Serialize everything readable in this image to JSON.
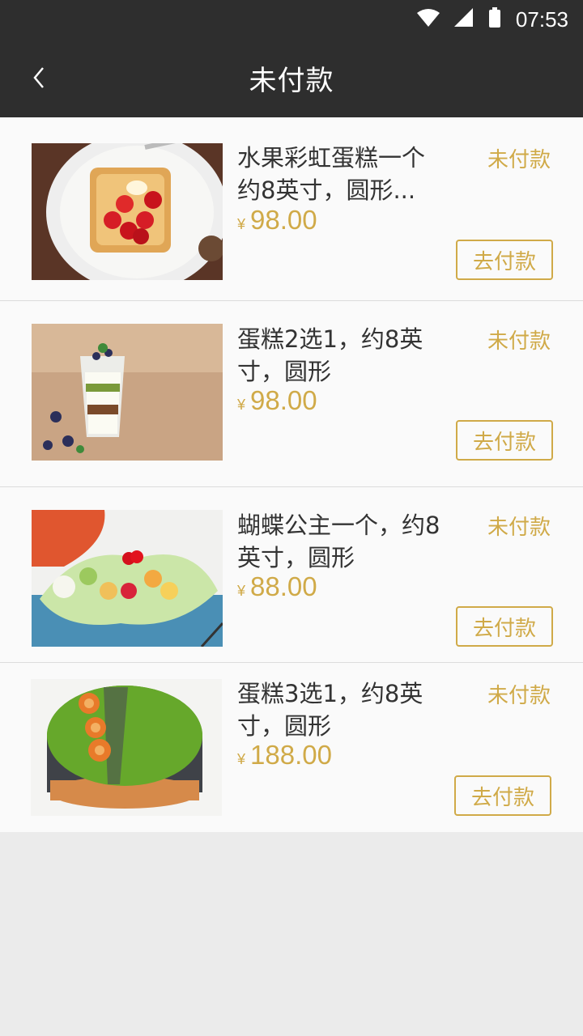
{
  "status_bar": {
    "time": "07:53"
  },
  "header": {
    "title": "未付款"
  },
  "orders": [
    {
      "name": "水果彩虹蛋糕一个约8英寸，圆形...",
      "status": "未付款",
      "currency": "¥",
      "price": "98.00",
      "action": "去付款"
    },
    {
      "name": "蛋糕2选1，约8英寸，圆形",
      "status": "未付款",
      "currency": "¥",
      "price": "98.00",
      "action": "去付款"
    },
    {
      "name": "蝴蝶公主一个，约8英寸，圆形",
      "status": "未付款",
      "currency": "¥",
      "price": "88.00",
      "action": "去付款"
    },
    {
      "name": "蛋糕3选1，约8英寸，圆形",
      "status": "未付款",
      "currency": "¥",
      "price": "188.00",
      "action": "去付款"
    }
  ],
  "colors": {
    "accent": "#d0aa48",
    "bar": "#2e2e2e",
    "background": "#ebebeb"
  },
  "icons": {
    "back": "chevron-left-icon",
    "wifi": "wifi-icon",
    "signal": "signal-icon",
    "battery": "battery-icon"
  }
}
